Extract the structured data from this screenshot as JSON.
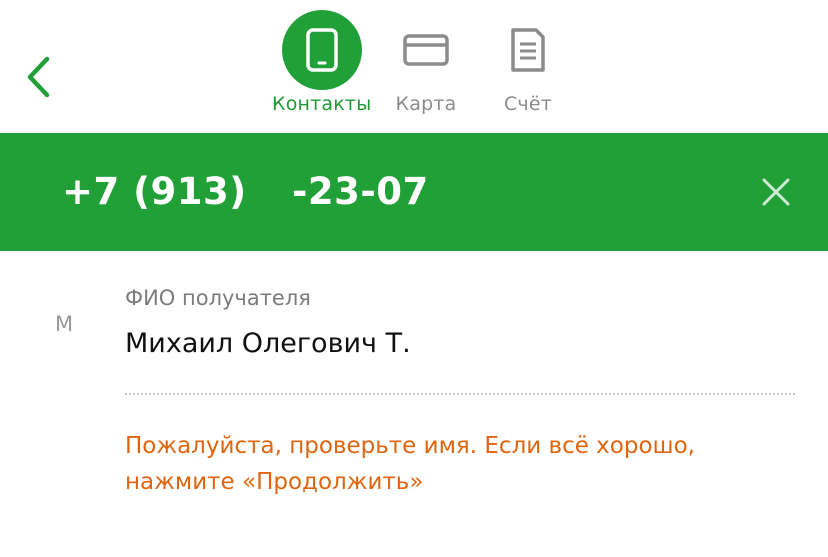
{
  "header": {
    "back_icon": "chevron-left-icon",
    "tabs": [
      {
        "label": "Контакты",
        "icon": "phone-icon",
        "active": true
      },
      {
        "label": "Карта",
        "icon": "card-icon",
        "active": false
      },
      {
        "label": "Счёт",
        "icon": "document-icon",
        "active": false
      }
    ]
  },
  "phone": {
    "prefix": "+7 (913)",
    "suffix": "-23-07",
    "clear_icon": "close-icon"
  },
  "recipient": {
    "avatar_letter": "М",
    "label": "ФИО получателя",
    "value": "Михаил Олегович Т."
  },
  "warning": {
    "text": "Пожалуйста, проверьте имя. Если всё хорошо, нажмите «Продолжить»"
  },
  "colors": {
    "accent_green": "#21a038",
    "warning_orange": "#e0650f",
    "inactive_gray": "#8c8c8c"
  }
}
